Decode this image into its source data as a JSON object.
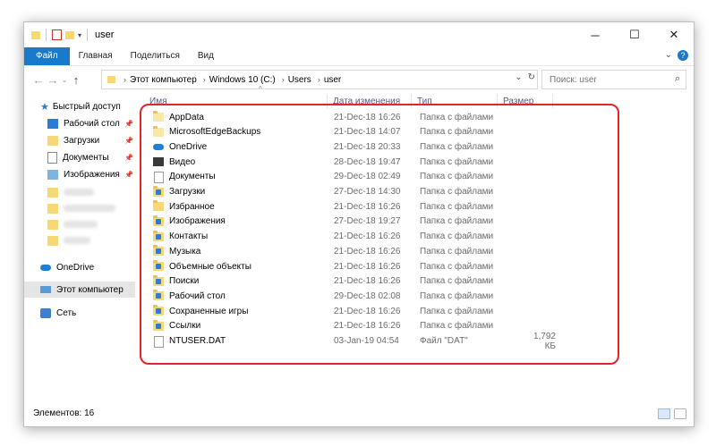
{
  "window": {
    "title": "user"
  },
  "window_controls": {
    "minimize": "─",
    "maximize": "☐",
    "close": "✕"
  },
  "ribbon": {
    "tabs": [
      "Файл",
      "Главная",
      "Поделиться",
      "Вид"
    ],
    "help": "?",
    "expand": "⌄"
  },
  "nav": {
    "back": "←",
    "forward": "→",
    "up_history": "⌄",
    "up": "↑",
    "breadcrumbs": [
      "Этот компьютер",
      "Windows 10 (C:)",
      "Users",
      "user"
    ],
    "address_dropdown": "⌄",
    "refresh": "↻",
    "search_placeholder": "Поиск: user",
    "search_icon": "search-icon"
  },
  "sidebar": {
    "quick_access": "Быстрый доступ",
    "pinned": [
      {
        "label": "Рабочий стол",
        "icon": "desktop-icon",
        "pin": "📌"
      },
      {
        "label": "Загрузки",
        "icon": "downloads-icon",
        "pin": "📌"
      },
      {
        "label": "Документы",
        "icon": "documents-icon",
        "pin": "📌"
      },
      {
        "label": "Изображения",
        "icon": "pictures-icon",
        "pin": "📌"
      }
    ],
    "onedrive": "OneDrive",
    "this_pc": "Этот компьютер",
    "network": "Сеть"
  },
  "columns": {
    "name": "Имя",
    "date": "Дата изменения",
    "type": "Тип",
    "size": "Размер",
    "sort_indicator": "^"
  },
  "files": [
    {
      "name": "AppData",
      "date": "21-Dec-18 16:26",
      "type": "Папка с файлами",
      "size": "",
      "icon": "folder-icon"
    },
    {
      "name": "MicrosoftEdgeBackups",
      "date": "21-Dec-18 14:07",
      "type": "Папка с файлами",
      "size": "",
      "icon": "folder-icon"
    },
    {
      "name": "OneDrive",
      "date": "21-Dec-18 20:33",
      "type": "Папка с файлами",
      "size": "",
      "icon": "onedrive-icon"
    },
    {
      "name": "Видео",
      "date": "28-Dec-18 19:47",
      "type": "Папка с файлами",
      "size": "",
      "icon": "videos-icon"
    },
    {
      "name": "Документы",
      "date": "29-Dec-18 02:49",
      "type": "Папка с файлами",
      "size": "",
      "icon": "documents-icon"
    },
    {
      "name": "Загрузки",
      "date": "27-Dec-18 14:30",
      "type": "Папка с файлами",
      "size": "",
      "icon": "downloads-icon"
    },
    {
      "name": "Избранное",
      "date": "21-Dec-18 16:26",
      "type": "Папка с файлами",
      "size": "",
      "icon": "favorites-icon"
    },
    {
      "name": "Изображения",
      "date": "27-Dec-18 19:27",
      "type": "Папка с файлами",
      "size": "",
      "icon": "pictures-icon"
    },
    {
      "name": "Контакты",
      "date": "21-Dec-18 16:26",
      "type": "Папка с файлами",
      "size": "",
      "icon": "contacts-icon"
    },
    {
      "name": "Музыка",
      "date": "21-Dec-18 16:26",
      "type": "Папка с файлами",
      "size": "",
      "icon": "music-icon"
    },
    {
      "name": "Объемные объекты",
      "date": "21-Dec-18 16:26",
      "type": "Папка с файлами",
      "size": "",
      "icon": "3d-objects-icon"
    },
    {
      "name": "Поиски",
      "date": "21-Dec-18 16:26",
      "type": "Папка с файлами",
      "size": "",
      "icon": "searches-icon"
    },
    {
      "name": "Рабочий стол",
      "date": "29-Dec-18 02:08",
      "type": "Папка с файлами",
      "size": "",
      "icon": "desktop-icon"
    },
    {
      "name": "Сохраненные игры",
      "date": "21-Dec-18 16:26",
      "type": "Папка с файлами",
      "size": "",
      "icon": "saved-games-icon"
    },
    {
      "name": "Ссылки",
      "date": "21-Dec-18 16:26",
      "type": "Папка с файлами",
      "size": "",
      "icon": "links-icon"
    },
    {
      "name": "NTUSER.DAT",
      "date": "03-Jan-19 04:54",
      "type": "Файл \"DAT\"",
      "size": "1,792 КБ",
      "icon": "file-icon"
    }
  ],
  "status": {
    "items": "Элементов: 16"
  },
  "colors": {
    "accent": "#1979ca",
    "highlight_border": "#e3242b",
    "folder": "#f8d775"
  }
}
